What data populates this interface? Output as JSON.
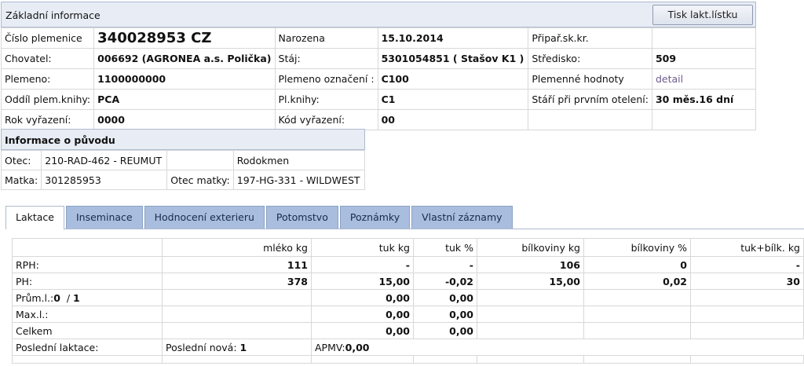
{
  "basic": {
    "title": "Základní informace",
    "print_button": "Tisk lakt.lístku",
    "rows": [
      [
        "Číslo plemenice",
        "340028953 CZ",
        "Narozena",
        "15.10.2014",
        "Připař.sk.kr.",
        ""
      ],
      [
        "Chovatel:",
        "006692 (AGRONEA a.s. Polička)",
        "Stáj:",
        "5301054851 ( Stašov K1 )",
        "Středisko:",
        "509"
      ],
      [
        "Plemeno:",
        "1100000000",
        "Plemeno označení :",
        "C100",
        "Plemenné hodnoty",
        "detail"
      ],
      [
        "Oddíl plem.knihy:",
        "PCA",
        "Pl.knihy:",
        "C1",
        "Stáří při prvním otelení:",
        "30 měs.16 dní"
      ],
      [
        "Rok vyřazení:",
        "0000",
        "Kód vyřazení:",
        "00",
        "",
        ""
      ]
    ]
  },
  "origin": {
    "title": "Informace o původu",
    "otec_label": "Otec:",
    "otec_value": "210-RAD-462 - REUMUT",
    "rodokmen": "Rodokmen",
    "matka_label": "Matka:",
    "matka_value": "301285953",
    "otec_matky_label": "Otec matky:",
    "otec_matky_value": "197-HG-331 - WILDWEST"
  },
  "tabs": [
    "Laktace",
    "Inseminace",
    "Hodnocení exterieru",
    "Potomstvo",
    "Poznámky",
    "Vlastní záznamy"
  ],
  "lact": {
    "headers": [
      "",
      "mléko kg",
      "tuk kg",
      "tuk %",
      "bílkoviny kg",
      "bílkoviny %",
      "tuk+bílk. kg"
    ],
    "rows": [
      [
        "RPH:",
        "111",
        "-",
        "-",
        "106",
        "0",
        "-"
      ],
      [
        "PH:",
        "378",
        "15,00",
        "-0,02",
        "15,00",
        "0,02",
        "30"
      ],
      [
        "",
        "",
        "0,00",
        "0,00",
        "",
        "",
        ""
      ],
      [
        "Max.l.:",
        "",
        "0,00",
        "0,00",
        "",
        "",
        ""
      ],
      [
        "Celkem",
        "",
        "0,00",
        "0,00",
        "",
        "",
        ""
      ]
    ],
    "prum_label": "Prům.l.:",
    "prum_value": "0",
    "prum_sep": "/",
    "prum_count": "1",
    "posledni_label": "Poslední laktace:",
    "posledni_nova_label": "Poslední nová:",
    "posledni_nova_value": "1",
    "apmv_label": "APMV:",
    "apmv_value": "0,00"
  }
}
